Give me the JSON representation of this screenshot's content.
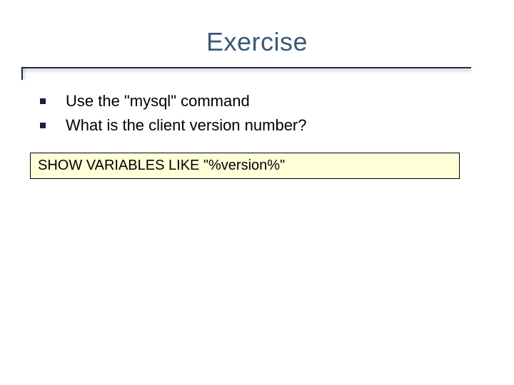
{
  "slide": {
    "title": "Exercise",
    "bullets": [
      {
        "text": "Use the \"mysql\" command"
      },
      {
        "text": "What is the client version number?"
      }
    ],
    "code": "SHOW VARIABLES LIKE \"%version%\""
  }
}
